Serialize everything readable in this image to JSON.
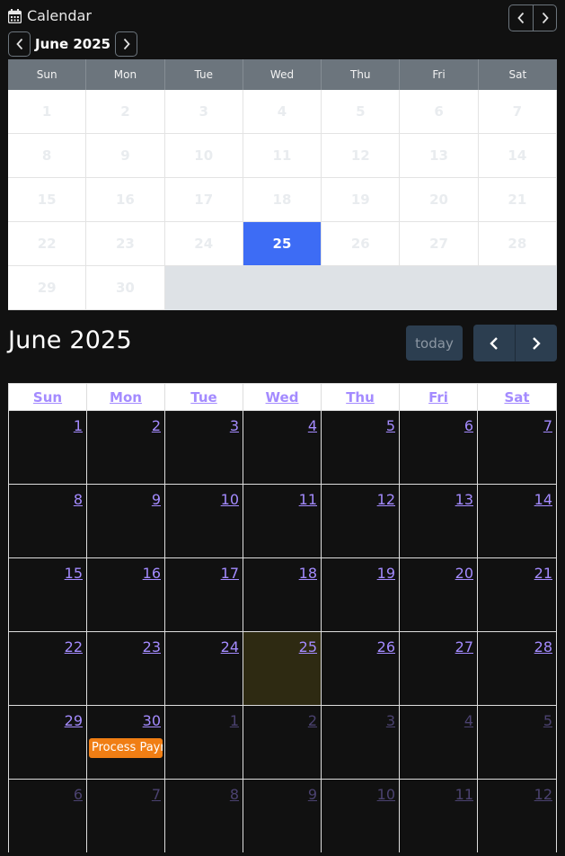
{
  "widget": {
    "title": "Calendar",
    "month_label": "June 2025",
    "weekdays": [
      "Sun",
      "Mon",
      "Tue",
      "Wed",
      "Thu",
      "Fri",
      "Sat"
    ],
    "weeks": [
      [
        "1",
        "2",
        "3",
        "4",
        "5",
        "6",
        "7"
      ],
      [
        "8",
        "9",
        "10",
        "11",
        "12",
        "13",
        "14"
      ],
      [
        "15",
        "16",
        "17",
        "18",
        "19",
        "20",
        "21"
      ],
      [
        "22",
        "23",
        "24",
        "25",
        "26",
        "27",
        "28"
      ],
      [
        "29",
        "30"
      ]
    ],
    "selected_day": "25",
    "colors": {
      "header_bg": "#6c757d",
      "selected": "#3d6cf5"
    }
  },
  "fullcalendar": {
    "title": "June 2025",
    "today_label": "today",
    "weekdays": [
      "Sun",
      "Mon",
      "Tue",
      "Wed",
      "Thu",
      "Fri",
      "Sat"
    ],
    "weeks": [
      [
        "1",
        "2",
        "3",
        "4",
        "5",
        "6",
        "7"
      ],
      [
        "8",
        "9",
        "10",
        "11",
        "12",
        "13",
        "14"
      ],
      [
        "15",
        "16",
        "17",
        "18",
        "19",
        "20",
        "21"
      ],
      [
        "22",
        "23",
        "24",
        "25",
        "26",
        "27",
        "28"
      ],
      [
        "29",
        "30",
        "1",
        "2",
        "3",
        "4",
        "5"
      ],
      [
        "6",
        "7",
        "8",
        "9",
        "10",
        "11",
        "12"
      ]
    ],
    "other_month_from": {
      "week": 4,
      "col": 2
    },
    "today": {
      "week": 3,
      "col": 3
    },
    "events": [
      {
        "week": 4,
        "col": 1,
        "title": "Process Payr",
        "color": "#f07e14"
      }
    ],
    "colors": {
      "link": "#a48bff",
      "today_bg": "#2e2a12",
      "button_bg": "#2c3e50"
    }
  }
}
